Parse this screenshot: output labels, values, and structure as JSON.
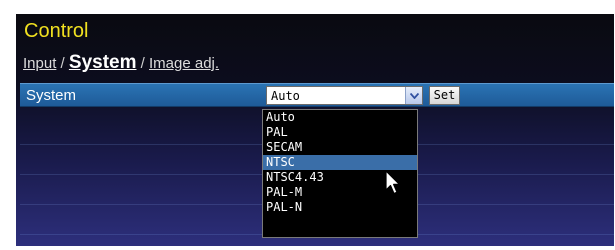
{
  "header": {
    "title": "Control"
  },
  "breadcrumb": {
    "input": "Input",
    "sep1": "/",
    "system": "System",
    "sep2": "/",
    "image_adj": "Image adj."
  },
  "system_row": {
    "label": "System",
    "select_value": "Auto",
    "set_label": "Set"
  },
  "dropdown": {
    "options": [
      "Auto",
      "PAL",
      "SECAM",
      "NTSC",
      "NTSC4.43",
      "PAL-M",
      "PAL-N"
    ],
    "highlighted": "NTSC"
  },
  "colors": {
    "title": "#f0e020",
    "row_bar": "#2b74b4",
    "highlight": "#3a6ea8"
  },
  "icons": {
    "select_arrow": "chevron-down-icon",
    "pointer": "mouse-cursor-icon"
  }
}
